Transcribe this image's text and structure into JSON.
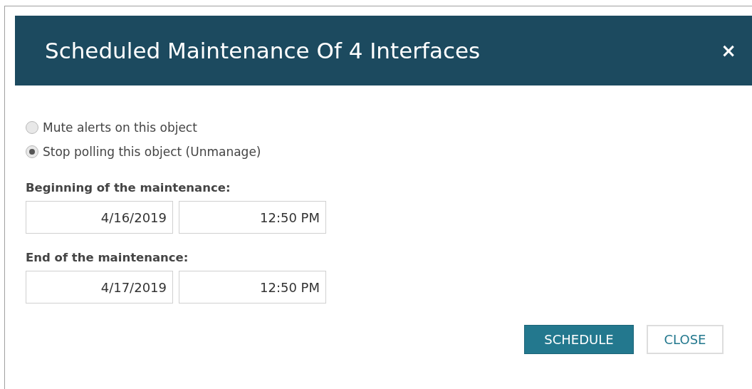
{
  "dialog": {
    "title": "Scheduled Maintenance Of 4 Interfaces",
    "close_icon": "×"
  },
  "options": [
    {
      "label": "Mute alerts on this object",
      "selected": false
    },
    {
      "label": "Stop polling this object (Unmanage)",
      "selected": true
    }
  ],
  "periods": [
    {
      "label": "Beginning of the maintenance:",
      "date": "4/16/2019",
      "time": "12:50 PM"
    },
    {
      "label": "End of the maintenance:",
      "date": "4/17/2019",
      "time": "12:50 PM"
    }
  ],
  "buttons": [
    {
      "label": "SCHEDULE",
      "kind": "primary"
    },
    {
      "label": "CLOSE",
      "kind": "secondary"
    }
  ]
}
